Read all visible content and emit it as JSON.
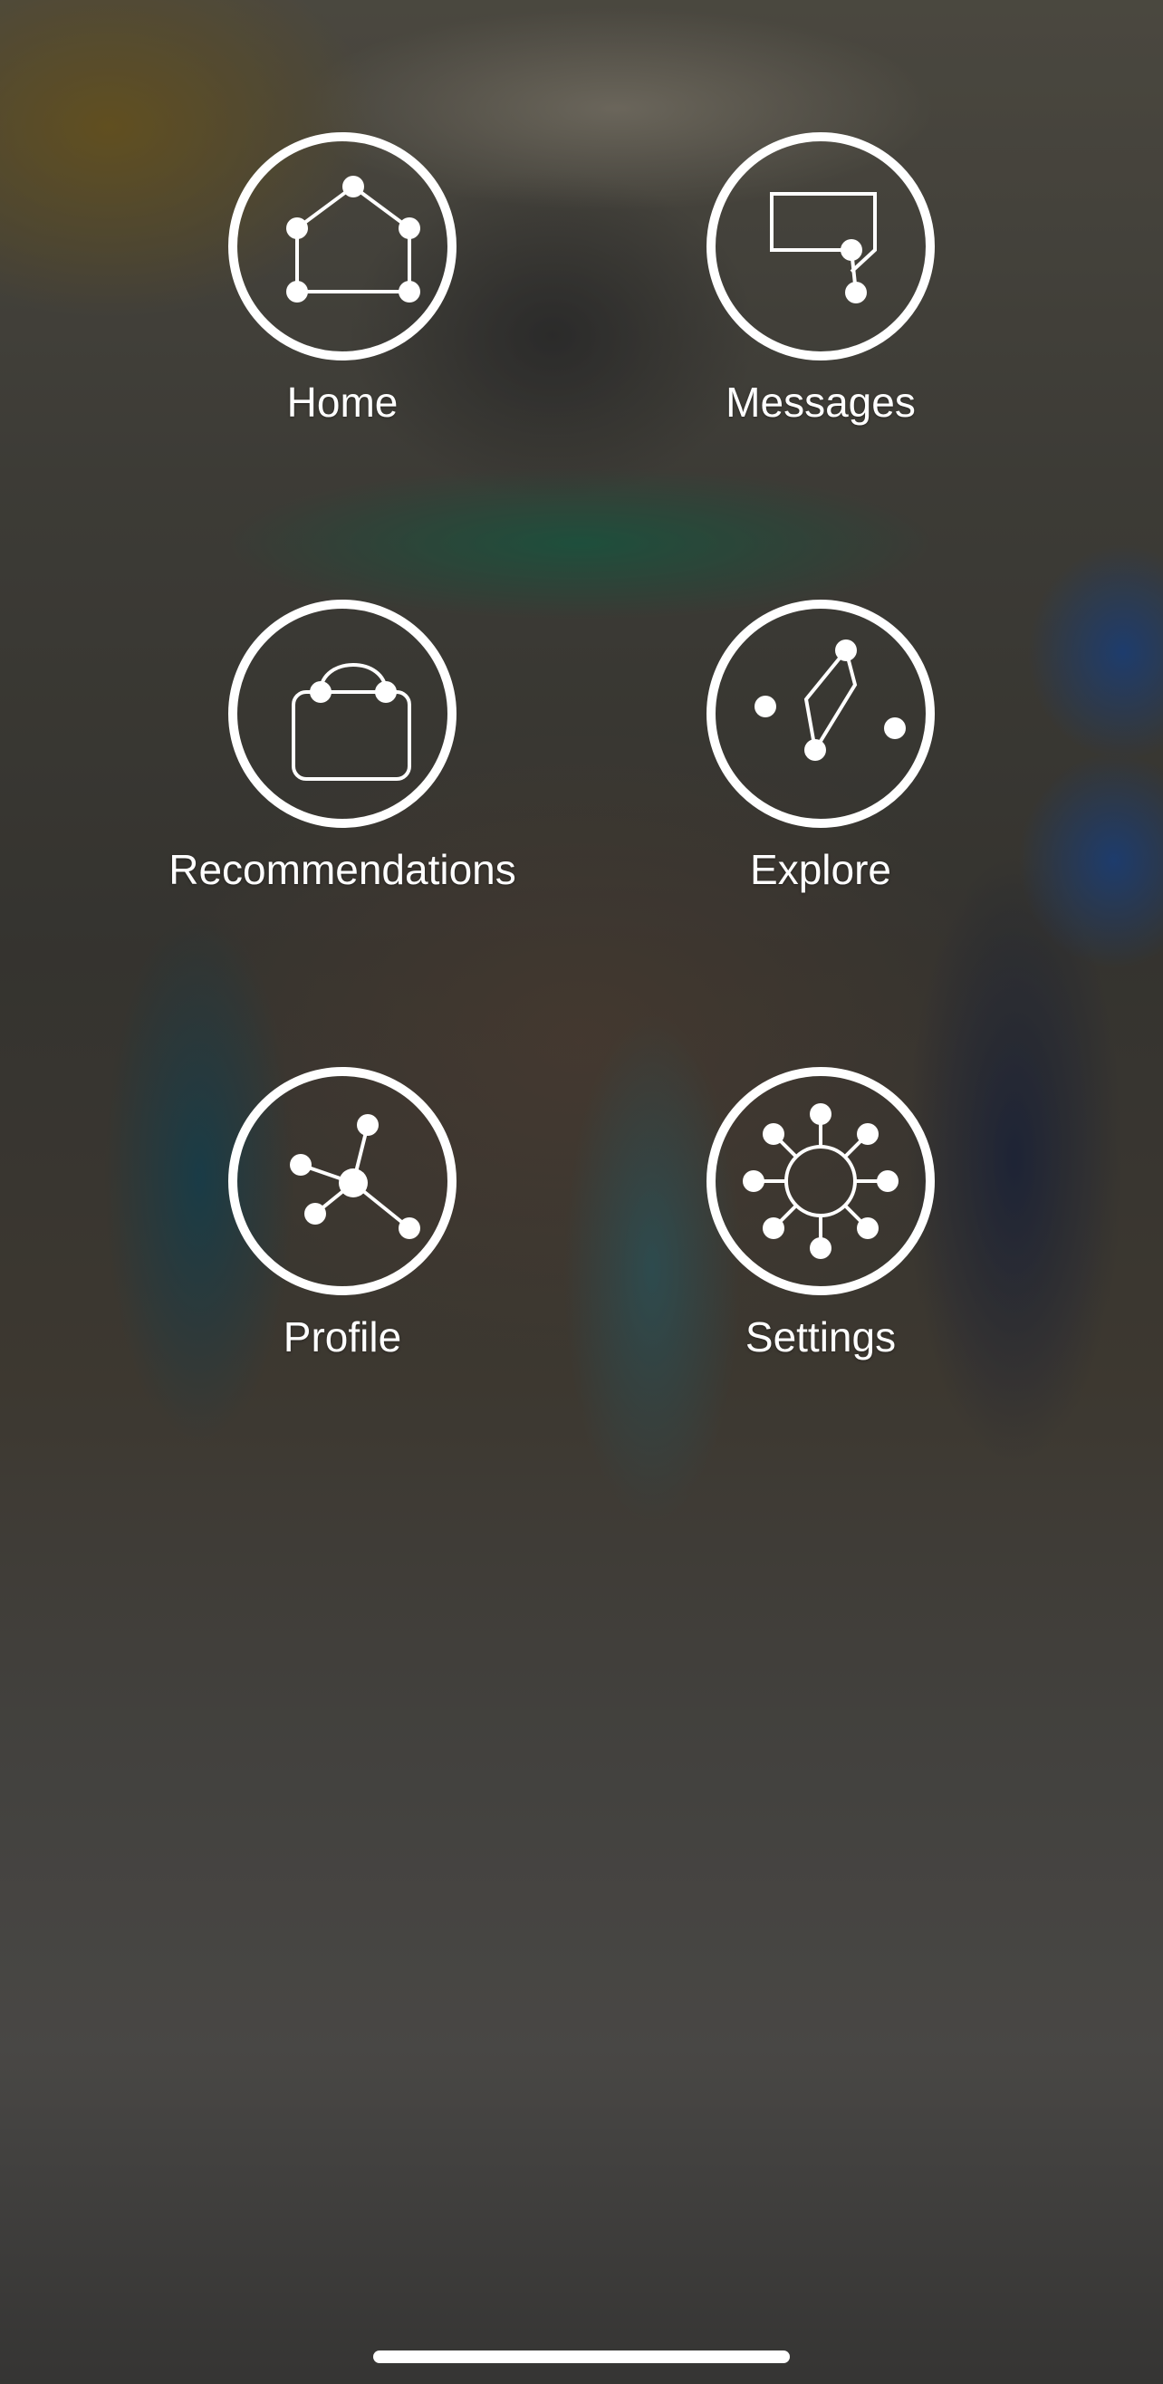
{
  "menu": {
    "items": [
      {
        "label": "Home",
        "icon": "home-icon"
      },
      {
        "label": "Messages",
        "icon": "messages-icon"
      },
      {
        "label": "Recommendations",
        "icon": "shopping-bag-icon"
      },
      {
        "label": "Explore",
        "icon": "explore-icon"
      },
      {
        "label": "Profile",
        "icon": "profile-network-icon"
      },
      {
        "label": "Settings",
        "icon": "settings-hub-icon"
      }
    ]
  },
  "colors": {
    "icon_stroke": "#ffffff",
    "label_text": "#ffffff",
    "overlay": "rgba(0,0,0,0.32)"
  }
}
